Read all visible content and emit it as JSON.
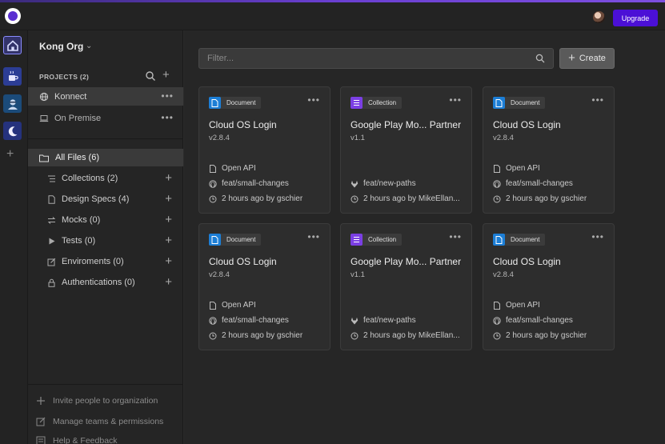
{
  "topbar": {
    "upgrade_label": "Upgrade"
  },
  "sidebar": {
    "org_name": "Kong Org",
    "projects_title": "PROJECTS (2)",
    "projects": [
      {
        "label": "Konnect",
        "icon": "globe-icon",
        "active": true
      },
      {
        "label": "On Premise",
        "icon": "laptop-icon",
        "active": false
      }
    ],
    "all_files": "All Files (6)",
    "categories": [
      {
        "label": "Collections (2)",
        "icon": "list-icon"
      },
      {
        "label": "Design Specs (4)",
        "icon": "document-icon"
      },
      {
        "label": "Mocks (0)",
        "icon": "swap-icon"
      },
      {
        "label": "Tests (0)",
        "icon": "play-icon"
      },
      {
        "label": "Enviroments (0)",
        "icon": "edit-icon"
      },
      {
        "label": "Authentications (0)",
        "icon": "lock-icon"
      }
    ],
    "footer": [
      {
        "label": "Invite people to organization",
        "icon": "plus-icon"
      },
      {
        "label": "Manage teams & permissions",
        "icon": "edit-icon"
      },
      {
        "label": "Help & Feedback",
        "icon": "help-icon"
      }
    ]
  },
  "main": {
    "filter_placeholder": "Filter...",
    "create_label": "Create",
    "cards": [
      {
        "type": "Document",
        "title": "Cloud OS Login",
        "version": "v2.8.4",
        "spec": "Open API",
        "branch": "feat/small-changes",
        "branch_icon": "github-icon",
        "updated": "2 hours ago by gschier"
      },
      {
        "type": "Collection",
        "title": "Google Play Mo... Partner",
        "version": "v1.1",
        "spec": "",
        "branch": "feat/new-paths",
        "branch_icon": "gitlab-icon",
        "updated": "2 hours ago by MikeEllan..."
      },
      {
        "type": "Document",
        "title": "Cloud OS Login",
        "version": "v2.8.4",
        "spec": "Open API",
        "branch": "feat/small-changes",
        "branch_icon": "github-icon",
        "updated": "2 hours ago by gschier"
      },
      {
        "type": "Document",
        "title": "Cloud OS Login",
        "version": "v2.8.4",
        "spec": "Open API",
        "branch": "feat/small-changes",
        "branch_icon": "github-icon",
        "updated": "2 hours ago by gschier"
      },
      {
        "type": "Collection",
        "title": "Google Play Mo... Partner",
        "version": "v1.1",
        "spec": "",
        "branch": "feat/new-paths",
        "branch_icon": "gitlab-icon",
        "updated": "2 hours ago by MikeEllan..."
      },
      {
        "type": "Document",
        "title": "Cloud OS Login",
        "version": "v2.8.4",
        "spec": "Open API",
        "branch": "feat/small-changes",
        "branch_icon": "github-icon",
        "updated": "2 hours ago by gschier"
      }
    ]
  },
  "colors": {
    "accent": "#4b10d6",
    "document_badge": "#1c7ed6",
    "collection_badge": "#7b3fe4"
  }
}
